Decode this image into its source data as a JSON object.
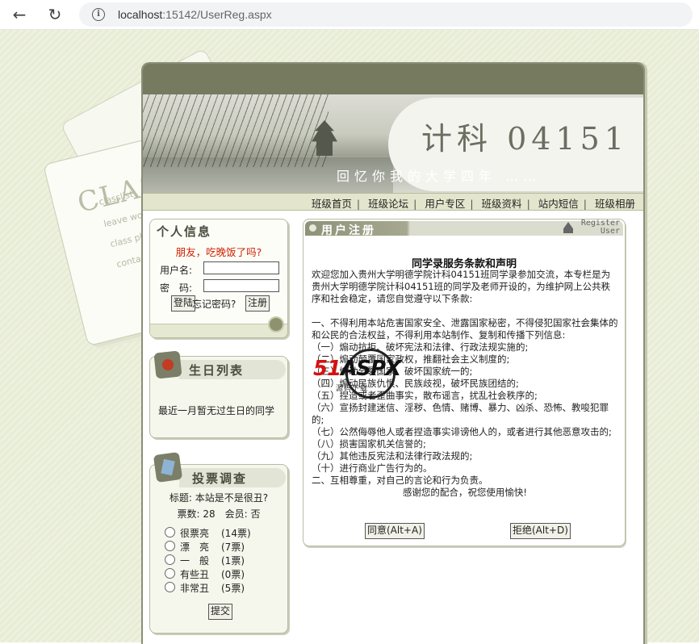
{
  "browser": {
    "url_host": "localhost",
    "url_path": ":15142/UserReg.aspx"
  },
  "decor": {
    "notebook_title": "CLASS",
    "lines": [
      "classlist",
      "leave wor",
      "class ph",
      "contac"
    ]
  },
  "banner": {
    "title": "计科 04151",
    "subtitle": "回忆你我的大学四年 ……"
  },
  "menu": {
    "items": [
      "班级首页",
      "班级论坛",
      "用户专区",
      "班级资料",
      "站内短信",
      "班级相册"
    ]
  },
  "login": {
    "title": "个人信息",
    "greeting": "朋友，吃晚饭了吗?",
    "username_label": "用户名:",
    "password_label": "密　码:",
    "login_button": "登陆",
    "forgot_link": "忘记密码?",
    "register_button": "注册"
  },
  "birthday": {
    "title": "生日列表",
    "text": "最近一月暂无过生日的同学"
  },
  "poll": {
    "title": "投票调查",
    "topic": "标题: 本站是不是很丑?",
    "meta": "票数: 28　会员: 否",
    "options": [
      {
        "label": "很票亮",
        "votes": "(14票)"
      },
      {
        "label": "漂　亮",
        "votes": "(7票)"
      },
      {
        "label": "一　般",
        "votes": "(1票)"
      },
      {
        "label": "有些丑",
        "votes": "(0票)"
      },
      {
        "label": "非常丑",
        "votes": "(5票)"
      }
    ],
    "submit": "提交"
  },
  "register": {
    "header": "用户注册",
    "header_en_1": "Register",
    "header_en_2": "User",
    "terms_title": "同学录服务条款和声明",
    "intro": "欢迎您加入贵州大学明德学院计科04151班同学录参加交流，本专栏是为贵州大学明德学院计科04151班的同学及老师开设的，为维护网上公共秩序和社会稳定，请您自觉遵守以下条款:",
    "clause1": "一、不得利用本站危害国家安全、泄露国家秘密，不得侵犯国家社会集体的和公民的合法权益，不得利用本站制作、复制和传播下列信息:",
    "items": [
      "（一）煽动抗拒、破坏宪法和法律、行政法规实施的;",
      "（二）煽动颠覆国家政权，推翻社会主义制度的;",
      "（三）煽动分裂国家、破坏国家统一的;",
      "（四）煽动民族仇恨、民族歧视，破坏民族团结的;",
      "（五）捏造或者歪曲事实，散布谣言，扰乱社会秩序的;",
      "（六）宣扬封建迷信、淫秽、色情、赌博、暴力、凶杀、恐怖、教唆犯罪的;",
      "（七）公然侮辱他人或者捏造事实诽谤他人的，或者进行其他恶意攻击的;",
      "（八）损害国家机关信誉的;",
      "（九）其他违反宪法和法律行政法规的;",
      "（十）进行商业广告行为的。"
    ],
    "clause2": "二、互相尊重，对自己的言论和行为负责。",
    "thanks": "感谢您的配合，祝您使用愉快!",
    "agree_button": "同意(Alt+A)",
    "reject_button": "拒绝(Alt+D)"
  },
  "watermark": {
    "brand_red": "51",
    "brand_dark": "ASPX",
    "sub": "源码下载"
  }
}
